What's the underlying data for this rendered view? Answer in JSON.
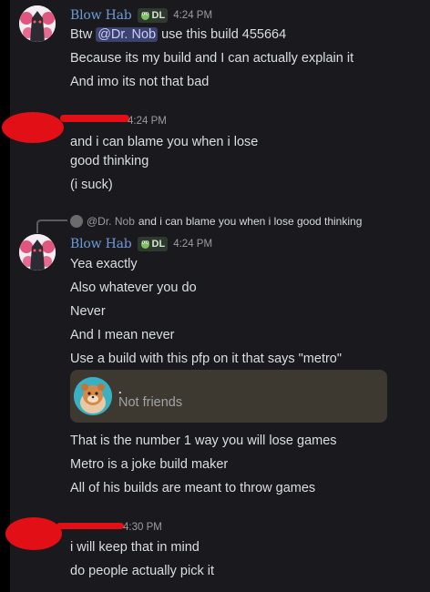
{
  "messages": [
    {
      "author": "Blow Hab",
      "badge": "DL",
      "time": "4:24 PM",
      "lines": [
        {
          "before": "Btw ",
          "mention": "@Dr. Nob",
          "after": " use this build 455664"
        },
        {
          "text": "Because its my build and I can actually explain it"
        },
        {
          "text": "And imo its not that bad"
        }
      ]
    },
    {
      "time": "4:24 PM",
      "lines": [
        {
          "text": "and i can blame you when i lose"
        },
        {
          "text": "good thinking"
        },
        {
          "text": "(i suck)"
        }
      ]
    },
    {
      "reply": {
        "name": "@Dr. Nob",
        "text": "and i can blame you when i lose good thinking"
      },
      "author": "Blow Hab",
      "badge": "DL",
      "time": "4:24 PM",
      "lines": [
        {
          "text": "Yea exactly"
        },
        {
          "text": "Also whatever you do"
        },
        {
          "text": "Never"
        },
        {
          "text": "And I mean never"
        },
        {
          "text": "Use a build with this pfp on it that says \"metro\""
        }
      ],
      "embed": {
        "name": ".",
        "status": "Not friends"
      },
      "lines_after": [
        {
          "text": "That is the number 1 way you will lose games"
        },
        {
          "text": "Metro is a joke build maker"
        },
        {
          "text": "All of his builds are meant to throw games"
        }
      ]
    },
    {
      "time": "4:30 PM",
      "lines": [
        {
          "text": "i will keep that in mind"
        },
        {
          "text": "do people actually pick it"
        }
      ]
    }
  ],
  "colors": {
    "background": "#1a1a1e",
    "username": "#6d9bd8",
    "mention_bg": "#3c4270",
    "redaction": "#e21016"
  },
  "icons": [
    "frog-emoji-icon",
    "reply-line-icon"
  ]
}
